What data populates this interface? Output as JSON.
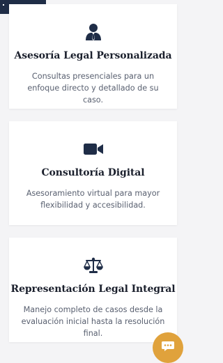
{
  "services": [
    {
      "icon": "user-tie-icon",
      "title": "Asesoría Legal Personalizada",
      "description": "Consultas presenciales para un enfoque directo y detallado de su caso."
    },
    {
      "icon": "video-camera-icon",
      "title": "Consultoría Digital",
      "description": "Asesoramiento virtual para mayor flexibilidad y accesibilidad."
    },
    {
      "icon": "balance-scale-icon",
      "title": "Representación Legal Integral",
      "description": "Manejo completo de casos desde la evaluación inicial hasta la resolución final."
    }
  ],
  "chat": {
    "icon": "chat-bubble-icon"
  },
  "colors": {
    "icon": "#1f2d47",
    "title": "#1a1f2c",
    "text": "#596070",
    "chat_button": "#e0a23c",
    "header_bar": "#1f2d47"
  }
}
